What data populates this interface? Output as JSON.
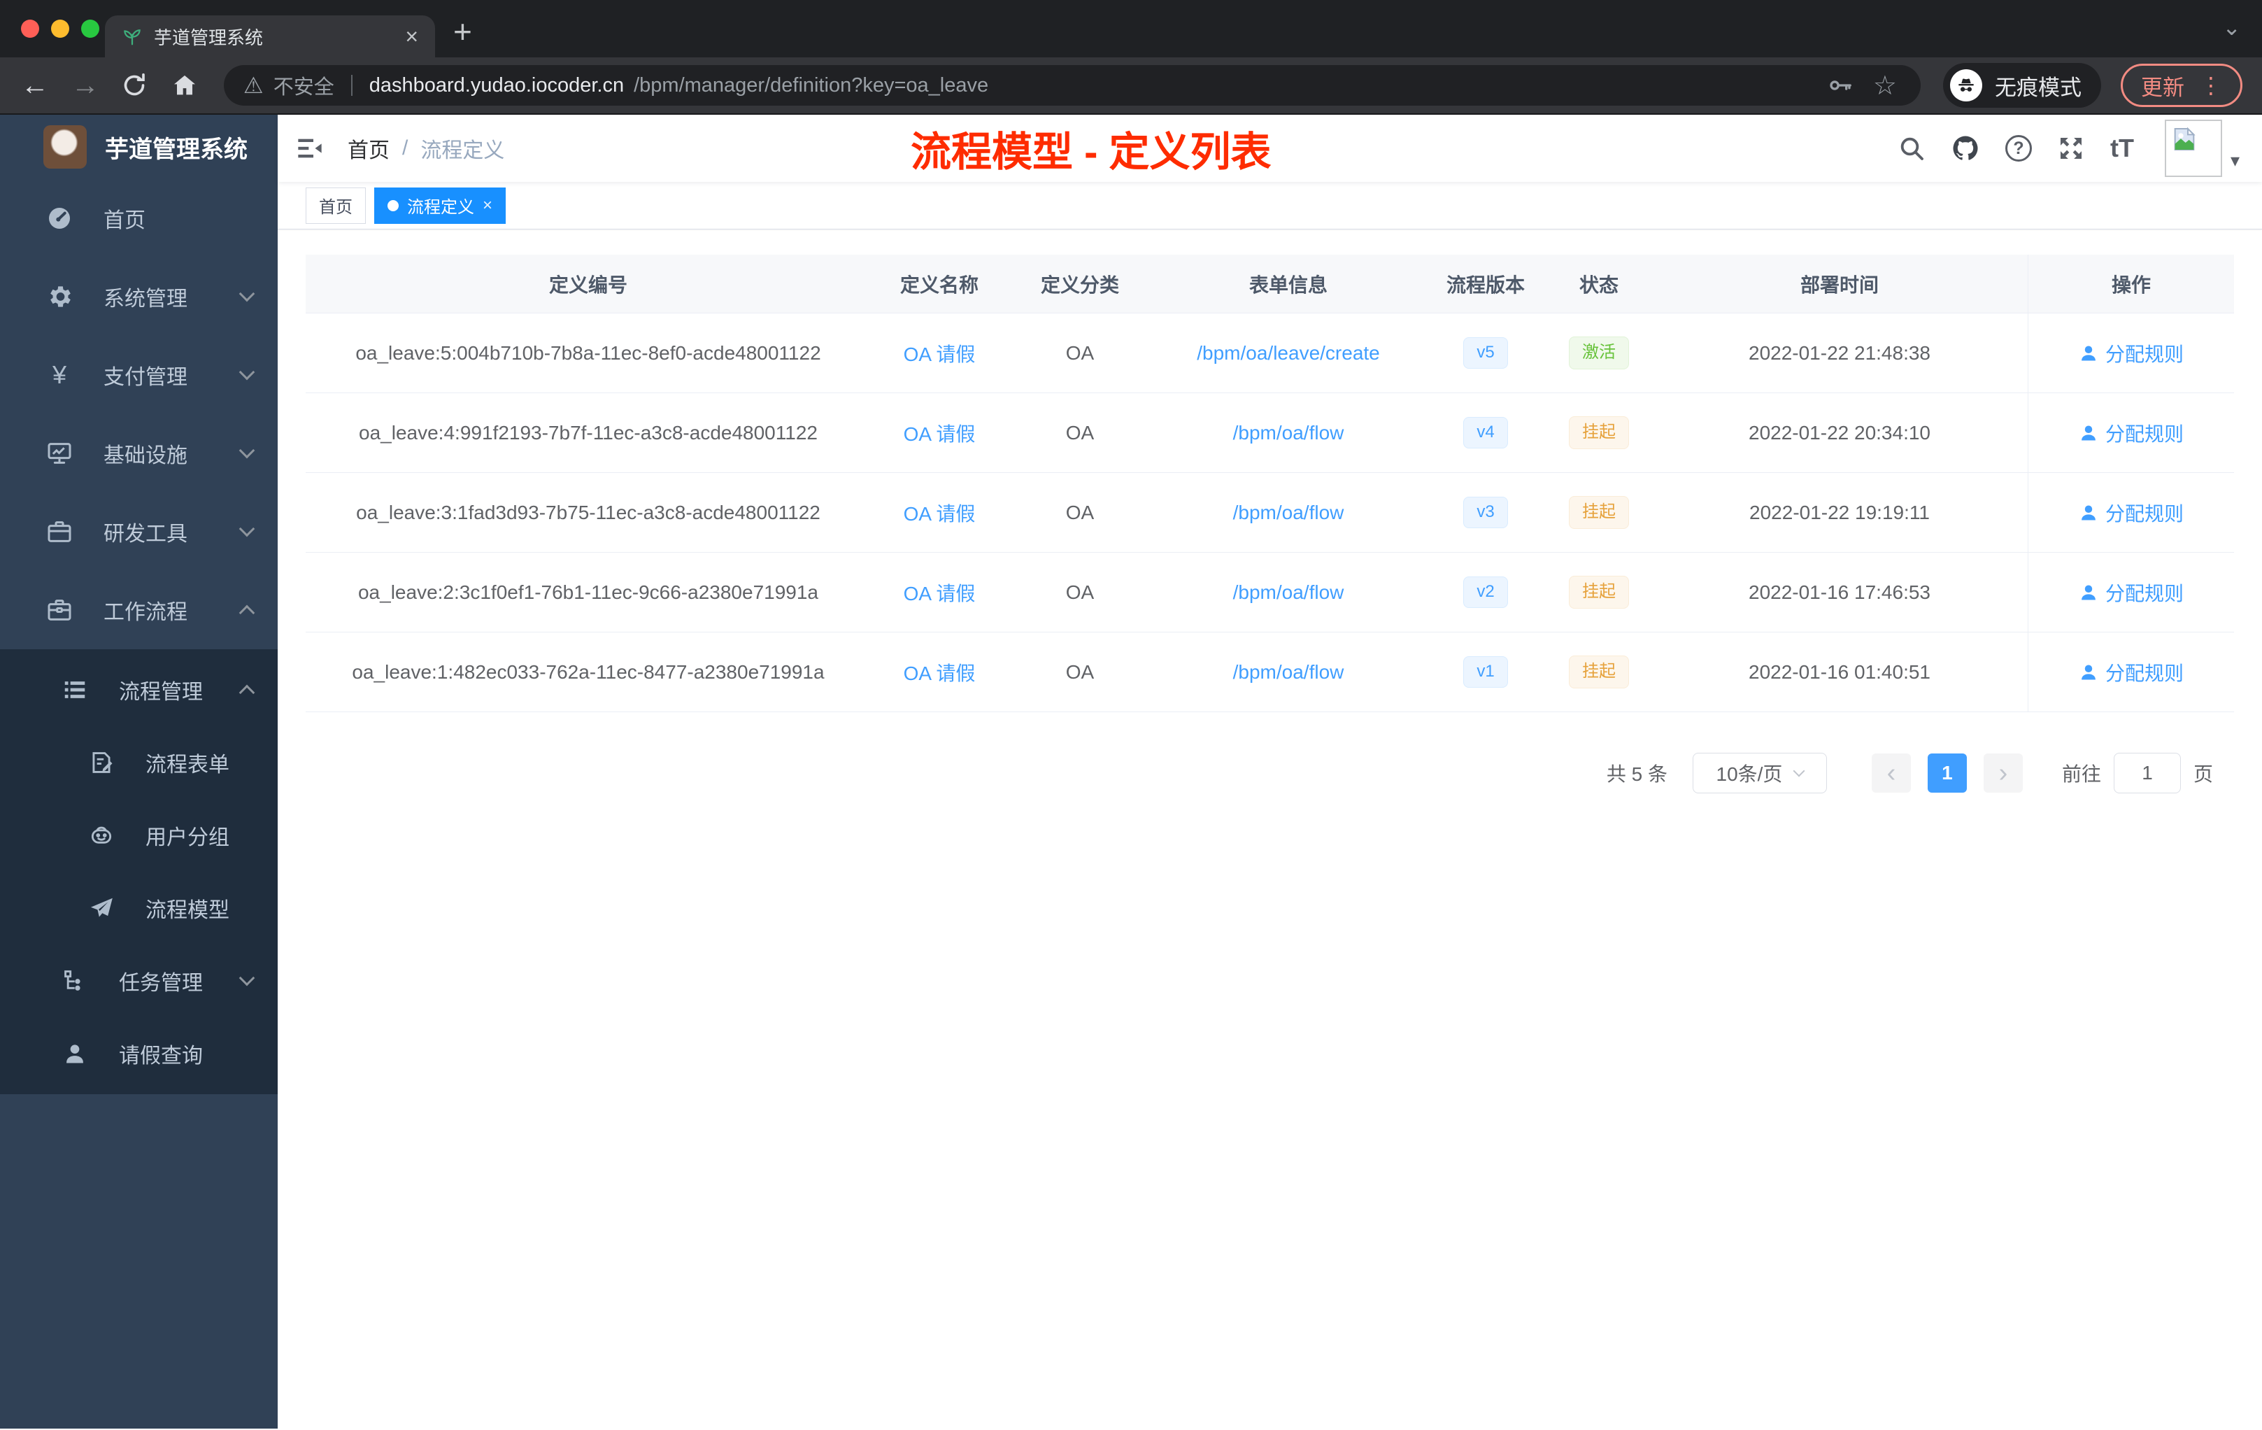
{
  "browser": {
    "tab": {
      "title": "芋道管理系统",
      "favicon": "sprout-icon"
    },
    "icons": {
      "close": "×",
      "plus": "+",
      "chevron_down": "⌄",
      "back": "←",
      "forward": "→",
      "star": "☆",
      "more_dots": "⋮",
      "caret_down": "▾",
      "warning": "⚠"
    },
    "toolbar": {
      "security_label": "不安全",
      "url_host": "dashboard.yudao.iocoder.cn",
      "url_path": "/bpm/manager/definition?key=oa_leave",
      "incognito_label": "无痕模式",
      "update_label": "更新"
    }
  },
  "sidebar": {
    "logo_title": "芋道管理系统",
    "items": [
      {
        "icon": "dashboard-icon",
        "label": "首页"
      },
      {
        "icon": "gear-icon",
        "label": "系统管理",
        "expanded": false
      },
      {
        "icon": "yen-icon",
        "label": "支付管理",
        "expanded": false,
        "yen": "¥"
      },
      {
        "icon": "infrastructure-icon",
        "label": "基础设施",
        "expanded": false
      },
      {
        "icon": "devtools-icon",
        "label": "研发工具",
        "expanded": false
      },
      {
        "icon": "workflow-icon",
        "label": "工作流程",
        "expanded": true
      }
    ],
    "workflow_children": {
      "process_management": {
        "icon": "list-icon",
        "label": "流程管理",
        "expanded": true
      },
      "process_children": [
        {
          "icon": "form-icon",
          "label": "流程表单"
        },
        {
          "icon": "user-group-icon",
          "label": "用户分组"
        },
        {
          "icon": "model-icon",
          "label": "流程模型"
        }
      ],
      "task_management": {
        "icon": "tree-icon",
        "label": "任务管理",
        "expanded": false
      },
      "leave_query": {
        "icon": "person-icon",
        "label": "请假查询"
      }
    }
  },
  "navbar": {
    "breadcrumb": {
      "home": "首页",
      "separator": "/",
      "current": "流程定义"
    },
    "annotation": {
      "text": "流程模型 - 定义列表",
      "color": "#fe2c00"
    },
    "font_icon_label": "tT"
  },
  "tagbar": {
    "tags": [
      {
        "label": "首页",
        "active": false
      },
      {
        "label": "流程定义",
        "active": true,
        "closable": true
      }
    ]
  },
  "table": {
    "columns": [
      "定义编号",
      "定义名称",
      "定义分类",
      "表单信息",
      "流程版本",
      "状态",
      "部署时间",
      "操作"
    ],
    "action_label": "分配规则",
    "rows": [
      {
        "id": "oa_leave:5:004b710b-7b8a-11ec-8ef0-acde48001122",
        "name": "OA 请假",
        "category": "OA",
        "form": "/bpm/oa/leave/create",
        "version": "v5",
        "status": {
          "label": "激活",
          "type": "success"
        },
        "deployed_at": "2022-01-22 21:48:38"
      },
      {
        "id": "oa_leave:4:991f2193-7b7f-11ec-a3c8-acde48001122",
        "name": "OA 请假",
        "category": "OA",
        "form": "/bpm/oa/flow",
        "version": "v4",
        "status": {
          "label": "挂起",
          "type": "warning"
        },
        "deployed_at": "2022-01-22 20:34:10"
      },
      {
        "id": "oa_leave:3:1fad3d93-7b75-11ec-a3c8-acde48001122",
        "name": "OA 请假",
        "category": "OA",
        "form": "/bpm/oa/flow",
        "version": "v3",
        "status": {
          "label": "挂起",
          "type": "warning"
        },
        "deployed_at": "2022-01-22 19:19:11"
      },
      {
        "id": "oa_leave:2:3c1f0ef1-76b1-11ec-9c66-a2380e71991a",
        "name": "OA 请假",
        "category": "OA",
        "form": "/bpm/oa/flow",
        "version": "v2",
        "status": {
          "label": "挂起",
          "type": "warning"
        },
        "deployed_at": "2022-01-16 17:46:53"
      },
      {
        "id": "oa_leave:1:482ec033-762a-11ec-8477-a2380e71991a",
        "name": "OA 请假",
        "category": "OA",
        "form": "/bpm/oa/flow",
        "version": "v1",
        "status": {
          "label": "挂起",
          "type": "warning"
        },
        "deployed_at": "2022-01-16 01:40:51"
      }
    ]
  },
  "pagination": {
    "total": "共 5 条",
    "page_size": "10条/页",
    "current_page": "1",
    "goto_label": "前往",
    "goto_value": "1",
    "unit_label": "页"
  },
  "colors": {
    "accent": "#409eff",
    "active_tag": "#1890ff",
    "status_active": "#67c23a",
    "status_suspended": "#e6a23c",
    "annotation_red": "#fe2c00",
    "sidebar_bg": "#304156",
    "submenu_bg": "#1f2d3d",
    "update_button": "#f28b82"
  }
}
